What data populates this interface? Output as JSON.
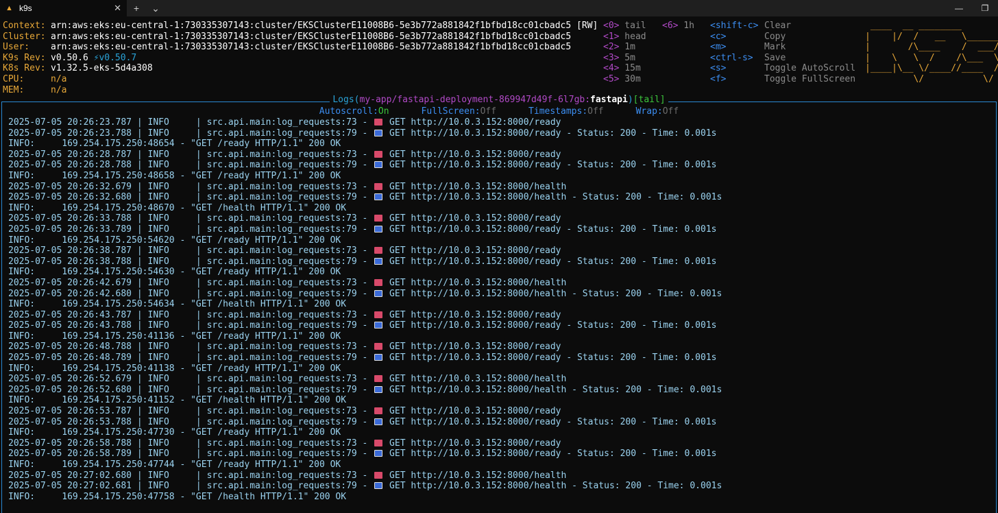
{
  "window": {
    "tab_title": "k9s",
    "tab_close": "✕",
    "new_tab": "+",
    "dropdown": "⌄",
    "minimize": "—",
    "maximize": "❐"
  },
  "info": [
    {
      "label": "Context:",
      "value": "arn:aws:eks:eu-central-1:730335307143:cluster/EKSClusterE11008B6-5e3b772a881842f1bfbd18cc01cbadc5 [RW]"
    },
    {
      "label": "Cluster:",
      "value": "arn:aws:eks:eu-central-1:730335307143:cluster/EKSClusterE11008B6-5e3b772a881842f1bfbd18cc01cbadc5"
    },
    {
      "label": "User:",
      "value": "arn:aws:eks:eu-central-1:730335307143:cluster/EKSClusterE11008B6-5e3b772a881842f1bfbd18cc01cbadc5"
    },
    {
      "label": "K9s Rev:",
      "value": "v0.50.6",
      "upgrade": "⚡v0.50.7"
    },
    {
      "label": "K8s Rev:",
      "value": "v1.32.5-eks-5d4a308"
    },
    {
      "label": "CPU:",
      "value": "n/a"
    },
    {
      "label": "MEM:",
      "value": "n/a"
    }
  ],
  "time_keys": [
    {
      "key": "<0>",
      "label": "tail"
    },
    {
      "key": "<1>",
      "label": "head"
    },
    {
      "key": "<2>",
      "label": "1m"
    },
    {
      "key": "<3>",
      "label": "5m"
    },
    {
      "key": "<4>",
      "label": "15m"
    },
    {
      "key": "<5>",
      "label": "30m"
    },
    {
      "key": "<6>",
      "label": "1h"
    }
  ],
  "action_keys": [
    {
      "key": "<shift-c>",
      "label": "Clear"
    },
    {
      "key": "<c>",
      "label": "Copy"
    },
    {
      "key": "<m>",
      "label": "Mark"
    },
    {
      "key": "<ctrl-s>",
      "label": "Save"
    },
    {
      "key": "<s>",
      "label": "Toggle AutoScroll"
    },
    {
      "key": "<f>",
      "label": "Toggle FullScreen"
    }
  ],
  "logo_lines": [
    " ____  __ ________",
    "|    |/  /   __   \\______",
    "|       /\\____    /  ___/",
    "|    \\   \\  /    /\\___  \\",
    "|____|\\__ \\/____//____  /",
    "         \\/           \\/"
  ],
  "logs_view": {
    "prefix": "Logs(",
    "path": "my-app/fastapi-deployment-869947d49f-6l7gb:",
    "container": "fastapi",
    "close": ")",
    "mode": "[tail]"
  },
  "status": {
    "autoscroll_label": "Autoscroll:",
    "autoscroll_value": "On",
    "fullscreen_label": "FullScreen:",
    "fullscreen_value": "Off",
    "timestamps_label": "Timestamps:",
    "timestamps_value": "Off",
    "wrap_label": "Wrap:",
    "wrap_value": "Off"
  },
  "log_lines": [
    {
      "pre": "2025-07-05 20:26:23.787 | INFO     | src.api.main:log_requests:73 - ",
      "emoji": "in",
      "post": " GET http://10.0.3.152:8000/ready"
    },
    {
      "pre": "2025-07-05 20:26:23.788 | INFO     | src.api.main:log_requests:79 - ",
      "emoji": "out",
      "post": " GET http://10.0.3.152:8000/ready - Status: 200 - Time: 0.001s"
    },
    {
      "pre": "INFO:     169.254.175.250:48654 - \"GET /ready HTTP/1.1\" 200 OK"
    },
    {
      "pre": "2025-07-05 20:26:28.787 | INFO     | src.api.main:log_requests:73 - ",
      "emoji": "in",
      "post": " GET http://10.0.3.152:8000/ready"
    },
    {
      "pre": "2025-07-05 20:26:28.788 | INFO     | src.api.main:log_requests:79 - ",
      "emoji": "out",
      "post": " GET http://10.0.3.152:8000/ready - Status: 200 - Time: 0.001s"
    },
    {
      "pre": "INFO:     169.254.175.250:48658 - \"GET /ready HTTP/1.1\" 200 OK"
    },
    {
      "pre": "2025-07-05 20:26:32.679 | INFO     | src.api.main:log_requests:73 - ",
      "emoji": "in",
      "post": " GET http://10.0.3.152:8000/health"
    },
    {
      "pre": "2025-07-05 20:26:32.680 | INFO     | src.api.main:log_requests:79 - ",
      "emoji": "out",
      "post": " GET http://10.0.3.152:8000/health - Status: 200 - Time: 0.001s"
    },
    {
      "pre": "INFO:     169.254.175.250:48670 - \"GET /health HTTP/1.1\" 200 OK"
    },
    {
      "pre": "2025-07-05 20:26:33.788 | INFO     | src.api.main:log_requests:73 - ",
      "emoji": "in",
      "post": " GET http://10.0.3.152:8000/ready"
    },
    {
      "pre": "2025-07-05 20:26:33.789 | INFO     | src.api.main:log_requests:79 - ",
      "emoji": "out",
      "post": " GET http://10.0.3.152:8000/ready - Status: 200 - Time: 0.001s"
    },
    {
      "pre": "INFO:     169.254.175.250:54620 - \"GET /ready HTTP/1.1\" 200 OK"
    },
    {
      "pre": "2025-07-05 20:26:38.787 | INFO     | src.api.main:log_requests:73 - ",
      "emoji": "in",
      "post": " GET http://10.0.3.152:8000/ready"
    },
    {
      "pre": "2025-07-05 20:26:38.788 | INFO     | src.api.main:log_requests:79 - ",
      "emoji": "out",
      "post": " GET http://10.0.3.152:8000/ready - Status: 200 - Time: 0.001s"
    },
    {
      "pre": "INFO:     169.254.175.250:54630 - \"GET /ready HTTP/1.1\" 200 OK"
    },
    {
      "pre": "2025-07-05 20:26:42.679 | INFO     | src.api.main:log_requests:73 - ",
      "emoji": "in",
      "post": " GET http://10.0.3.152:8000/health"
    },
    {
      "pre": "2025-07-05 20:26:42.680 | INFO     | src.api.main:log_requests:79 - ",
      "emoji": "out",
      "post": " GET http://10.0.3.152:8000/health - Status: 200 - Time: 0.001s"
    },
    {
      "pre": "INFO:     169.254.175.250:54634 - \"GET /health HTTP/1.1\" 200 OK"
    },
    {
      "pre": "2025-07-05 20:26:43.787 | INFO     | src.api.main:log_requests:73 - ",
      "emoji": "in",
      "post": " GET http://10.0.3.152:8000/ready"
    },
    {
      "pre": "2025-07-05 20:26:43.788 | INFO     | src.api.main:log_requests:79 - ",
      "emoji": "out",
      "post": " GET http://10.0.3.152:8000/ready - Status: 200 - Time: 0.001s"
    },
    {
      "pre": "INFO:     169.254.175.250:41136 - \"GET /ready HTTP/1.1\" 200 OK"
    },
    {
      "pre": "2025-07-05 20:26:48.788 | INFO     | src.api.main:log_requests:73 - ",
      "emoji": "in",
      "post": " GET http://10.0.3.152:8000/ready"
    },
    {
      "pre": "2025-07-05 20:26:48.789 | INFO     | src.api.main:log_requests:79 - ",
      "emoji": "out",
      "post": " GET http://10.0.3.152:8000/ready - Status: 200 - Time: 0.001s"
    },
    {
      "pre": "INFO:     169.254.175.250:41138 - \"GET /ready HTTP/1.1\" 200 OK"
    },
    {
      "pre": "2025-07-05 20:26:52.679 | INFO     | src.api.main:log_requests:73 - ",
      "emoji": "in",
      "post": " GET http://10.0.3.152:8000/health"
    },
    {
      "pre": "2025-07-05 20:26:52.680 | INFO     | src.api.main:log_requests:79 - ",
      "emoji": "out",
      "post": " GET http://10.0.3.152:8000/health - Status: 200 - Time: 0.001s"
    },
    {
      "pre": "INFO:     169.254.175.250:41152 - \"GET /health HTTP/1.1\" 200 OK"
    },
    {
      "pre": "2025-07-05 20:26:53.787 | INFO     | src.api.main:log_requests:73 - ",
      "emoji": "in",
      "post": " GET http://10.0.3.152:8000/ready"
    },
    {
      "pre": "2025-07-05 20:26:53.788 | INFO     | src.api.main:log_requests:79 - ",
      "emoji": "out",
      "post": " GET http://10.0.3.152:8000/ready - Status: 200 - Time: 0.001s"
    },
    {
      "pre": "INFO:     169.254.175.250:47730 - \"GET /ready HTTP/1.1\" 200 OK"
    },
    {
      "pre": "2025-07-05 20:26:58.788 | INFO     | src.api.main:log_requests:73 - ",
      "emoji": "in",
      "post": " GET http://10.0.3.152:8000/ready"
    },
    {
      "pre": "2025-07-05 20:26:58.789 | INFO     | src.api.main:log_requests:79 - ",
      "emoji": "out",
      "post": " GET http://10.0.3.152:8000/ready - Status: 200 - Time: 0.001s"
    },
    {
      "pre": "INFO:     169.254.175.250:47744 - \"GET /ready HTTP/1.1\" 200 OK"
    },
    {
      "pre": "2025-07-05 20:27:02.680 | INFO     | src.api.main:log_requests:73 - ",
      "emoji": "in",
      "post": " GET http://10.0.3.152:8000/health"
    },
    {
      "pre": "2025-07-05 20:27:02.681 | INFO     | src.api.main:log_requests:79 - ",
      "emoji": "out",
      "post": " GET http://10.0.3.152:8000/health - Status: 200 - Time: 0.001s"
    },
    {
      "pre": "INFO:     169.254.175.250:47758 - \"GET /health HTTP/1.1\" 200 OK"
    }
  ]
}
